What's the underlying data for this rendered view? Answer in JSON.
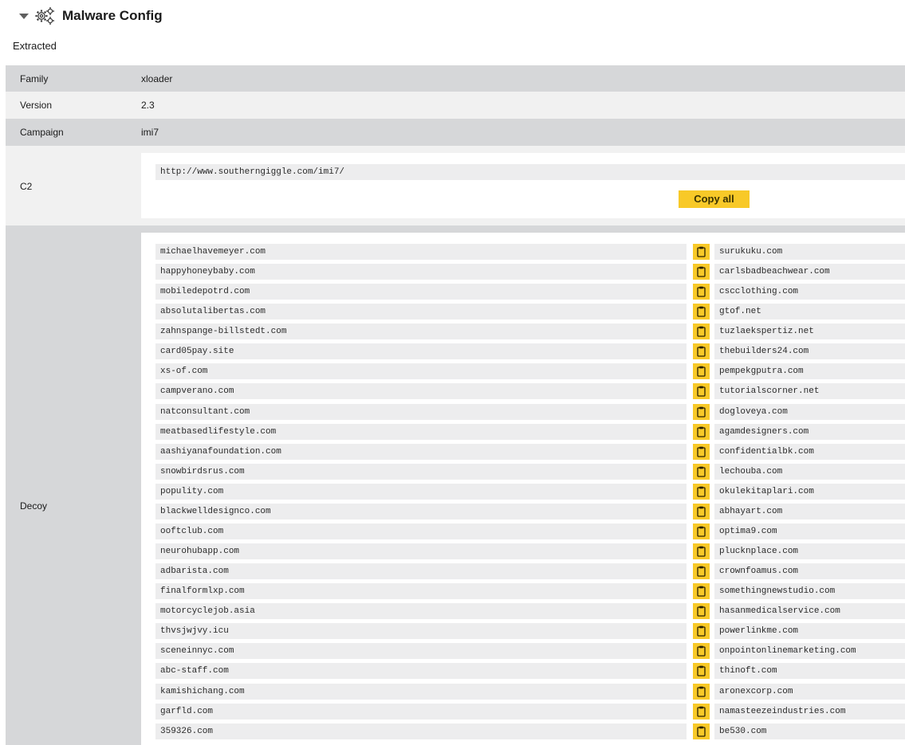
{
  "header": {
    "title": "Malware Config"
  },
  "section": {
    "subtitle": "Extracted"
  },
  "fields": {
    "family": {
      "label": "Family",
      "value": "xloader"
    },
    "version": {
      "label": "Version",
      "value": "2.3"
    },
    "campaign": {
      "label": "Campaign",
      "value": "imi7"
    }
  },
  "c2": {
    "label": "C2",
    "url": "http://www.southerngiggle.com/imi7/",
    "copy_all_label": "Copy all"
  },
  "decoy": {
    "label": "Decoy",
    "items": [
      [
        "michaelhavemeyer.com",
        "surukuku.com"
      ],
      [
        "happyhoneybaby.com",
        "carlsbadbeachwear.com"
      ],
      [
        "mobiledepotrd.com",
        "cscclothing.com"
      ],
      [
        "absolutalibertas.com",
        "gtof.net"
      ],
      [
        "zahnspange-billstedt.com",
        "tuzlaekspertiz.net"
      ],
      [
        "card05pay.site",
        "thebuilders24.com"
      ],
      [
        "xs-of.com",
        "pempekgputra.com"
      ],
      [
        "campverano.com",
        "tutorialscorner.net"
      ],
      [
        "natconsultant.com",
        "dogloveya.com"
      ],
      [
        "meatbasedlifestyle.com",
        "agamdesigners.com"
      ],
      [
        "aashiyanafoundation.com",
        "confidentialbk.com"
      ],
      [
        "snowbirdsrus.com",
        "lechouba.com"
      ],
      [
        "populity.com",
        "okulekitaplari.com"
      ],
      [
        "blackwelldesignco.com",
        "abhayart.com"
      ],
      [
        "ooftclub.com",
        "optima9.com"
      ],
      [
        "neurohubapp.com",
        "plucknplace.com"
      ],
      [
        "adbarista.com",
        "crownfoamus.com"
      ],
      [
        "finalformlxp.com",
        "somethingnewstudio.com"
      ],
      [
        "motorcyclejob.asia",
        "hasanmedicalservice.com"
      ],
      [
        "thvsjwjvy.icu",
        "powerlinkme.com"
      ],
      [
        "sceneinnyc.com",
        "onpointonlinemarketing.com"
      ],
      [
        "abc-staff.com",
        "thinoft.com"
      ],
      [
        "kamishichang.com",
        "aronexcorp.com"
      ],
      [
        "garfld.com",
        "namasteezeindustries.com"
      ],
      [
        "359326.com",
        "be530.com"
      ]
    ]
  }
}
